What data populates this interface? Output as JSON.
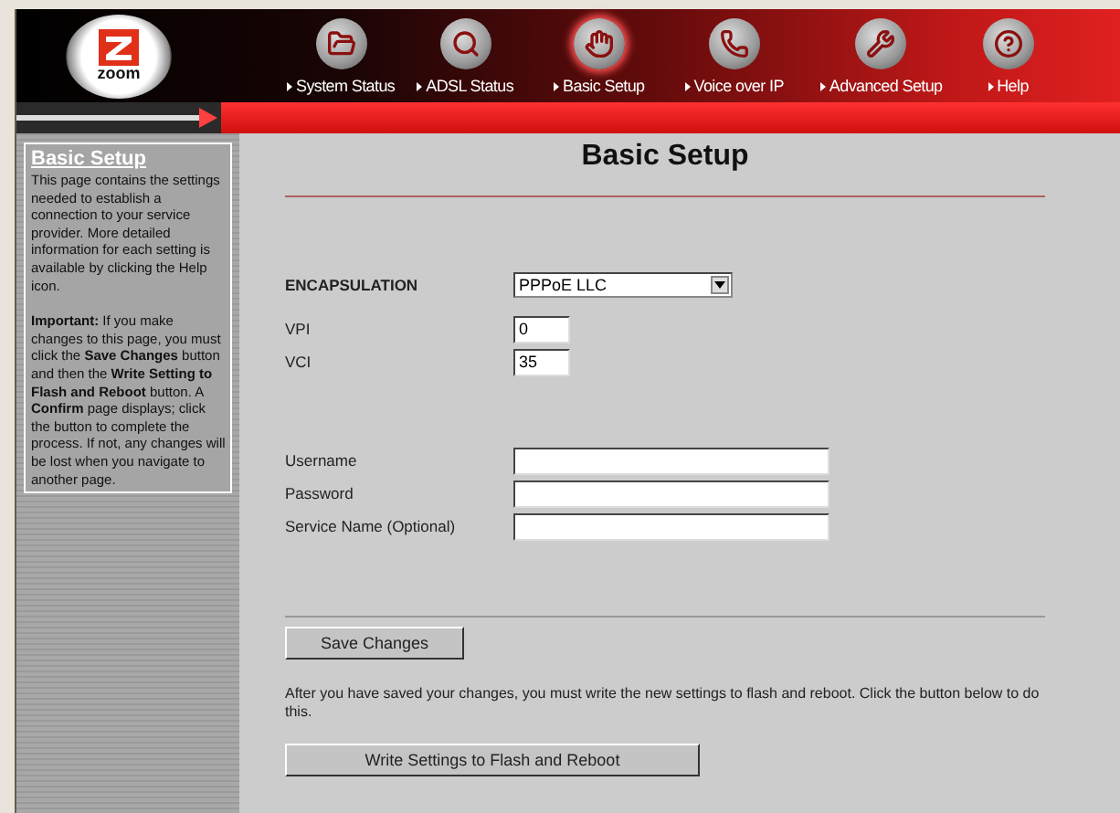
{
  "header": {
    "logo": "zoom",
    "nav": [
      {
        "label": "System Status",
        "selected": false
      },
      {
        "label": "ADSL Status",
        "selected": false
      },
      {
        "label": "Basic Setup",
        "selected": true
      },
      {
        "label": "Voice over IP",
        "selected": false
      },
      {
        "label": "Advanced Setup",
        "selected": false
      },
      {
        "label": "Help",
        "selected": false
      }
    ]
  },
  "sidebar": {
    "title": "Basic Setup",
    "paragraphs": [
      "This page contains the settings needed to establish a connection to your service provider. More detailed information for each setting is available by clicking the Help icon.",
      "**Important:** If you make changes to this page, you must click the **Save Changes** button and then the **Write Setting to Flash and Reboot** button. A **Confirm** page displays; click the button to complete the process. If not, any changes will be lost when you navigate to another page."
    ]
  },
  "main": {
    "title": "Basic Setup",
    "encapsulation": {
      "label": "ENCAPSULATION",
      "value": "PPPoE LLC"
    },
    "vc_fields": [
      {
        "label": "VPI",
        "value": "0"
      },
      {
        "label": "VCI",
        "value": "35"
      }
    ],
    "account_fields": [
      {
        "label": "Username"
      },
      {
        "label": "Password"
      },
      {
        "label": "Service Name (Optional)"
      }
    ],
    "save_button": "Save Changes",
    "note": "After you have saved your changes, you must write the new settings to flash and reboot. Click the button below to do this.",
    "write_button": "Write Settings to Flash and Reboot"
  }
}
